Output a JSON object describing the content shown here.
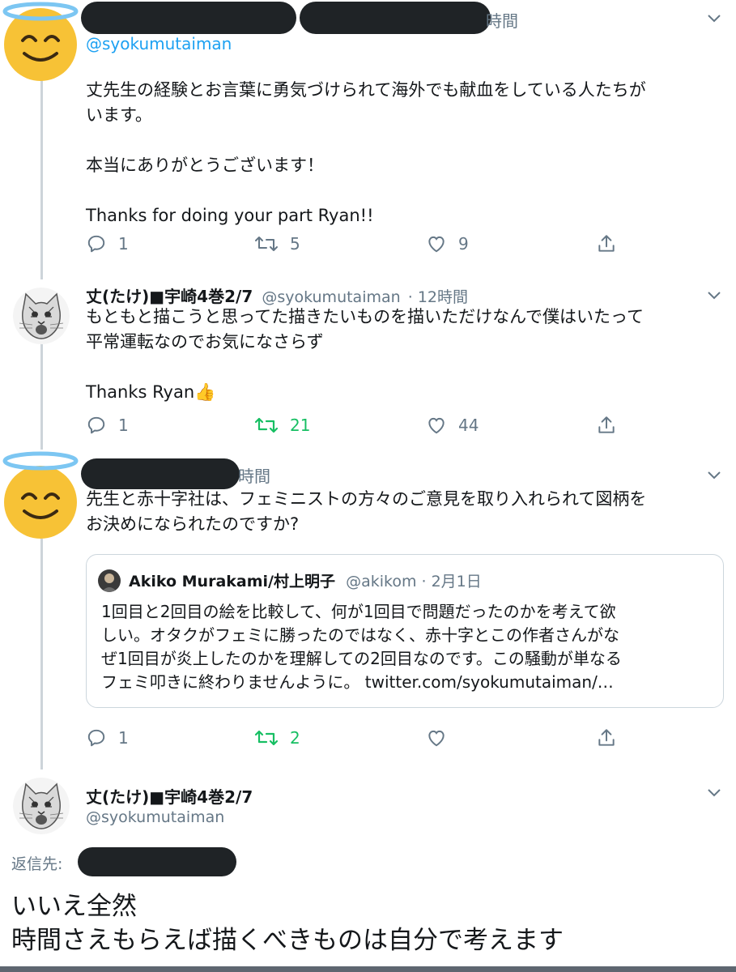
{
  "tweet1": {
    "time_fragment": "時間",
    "handle": "@syokumutaiman",
    "body": "丈先生の経験とお言葉に勇気づけられて海外でも献血をしている人たちが\nいます。\n\n本当にありがとうございます！\n\nThanks for doing your part Ryan!!",
    "reply_count": "1",
    "retweet_count": "5",
    "like_count": "9"
  },
  "tweet2": {
    "name": "丈(たけ)■宇崎4巻2/7",
    "handle": "@syokumutaiman",
    "time": "· 12時間",
    "body": "もともと描こうと思ってた描きたいものを描いただけなんで僕はいたって\n平常運転なのでお気になさらず\n\nThanks Ryan",
    "emoji": "👍",
    "reply_count": "1",
    "retweet_count": "21",
    "like_count": "44"
  },
  "tweet3": {
    "time_fragment": "時間",
    "body": "先生と赤十字社は、フェミニストの方々のご意見を取り入れられて図柄を\nお決めになられたのですか?",
    "quote": {
      "name": "Akiko Murakami/村上明子",
      "handle": "@akikom · 2月1日",
      "body": "1回目と2回目の絵を比較して、何が1回目で問題だったのかを考えて欲\nしい。オタクがフェミに勝ったのではなく、赤十字とこの作者さんがな\nぜ1回目が炎上したのかを理解しての2回目なのです。この騒動が単なる\nフェミ叩きに終わりませんように。",
      "link": "twitter.com/syokumutaiman/…"
    },
    "reply_count": "1",
    "retweet_count": "2"
  },
  "tweet4": {
    "name": "丈(たけ)■宇崎4巻2/7",
    "handle": "@syokumutaiman",
    "reply_to_label": "返信先:",
    "body": "いいえ全然\n時間さえもらえば描くべきものは自分で考えます"
  },
  "colors": {
    "accent_blue": "#1da1f2",
    "retweet_green": "#17bf63",
    "secondary_gray": "#657786",
    "redaction": "#1f2326"
  },
  "icons": [
    "halo-smiley-avatar",
    "cat-avatar",
    "reply-icon",
    "retweet-icon",
    "like-icon",
    "share-icon",
    "chevron-down-icon"
  ]
}
